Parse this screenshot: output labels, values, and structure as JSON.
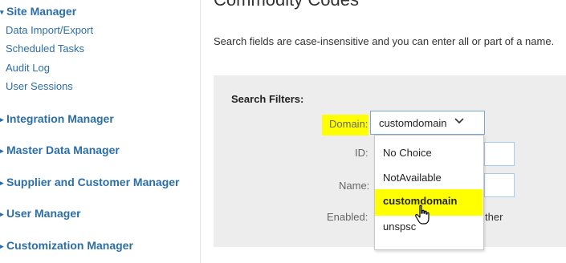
{
  "sidebar": {
    "site_manager": "Site Manager",
    "site_items": [
      "Data Import/Export",
      "Scheduled Tasks",
      "Audit Log",
      "User Sessions"
    ],
    "sections": [
      "Integration Manager",
      "Master Data Manager",
      "Supplier and Customer Manager",
      "User Manager",
      "Customization Manager"
    ]
  },
  "main": {
    "title": "Commodity Codes",
    "intro": "Search fields are case-insensitive and you can enter all or part of a name.",
    "filters": {
      "heading": "Search Filters:",
      "domain_label": "Domain:",
      "domain_value": "customdomain",
      "id_label": "ID:",
      "name_label": "Name:",
      "enabled_label": "Enabled:",
      "enabled_partial_text": "ther",
      "options": [
        "No Choice",
        "NotAvailable",
        "customdomain",
        "unspsc"
      ],
      "highlighted_option": "customdomain"
    }
  },
  "colors": {
    "link": "#2c6ea6",
    "highlight": "#ffff00",
    "panel": "#ededed"
  }
}
